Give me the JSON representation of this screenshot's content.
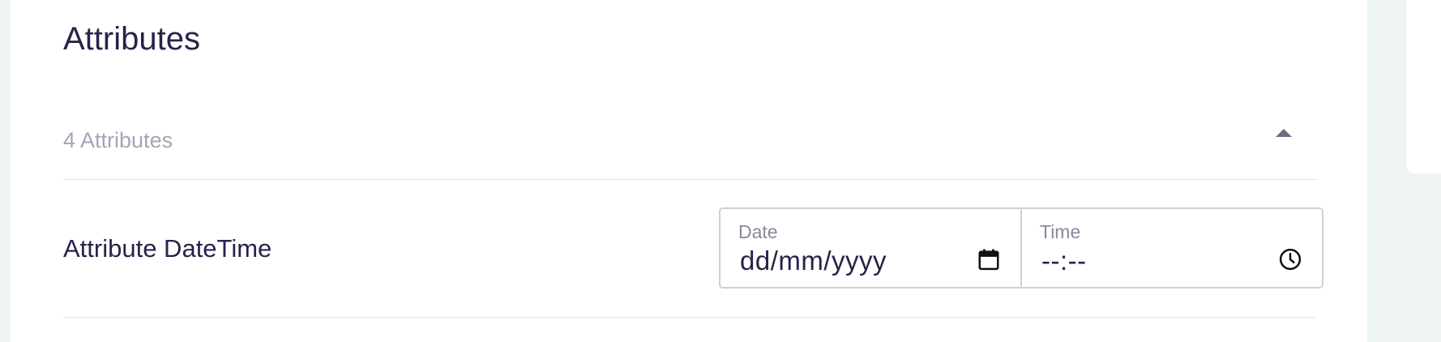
{
  "section": {
    "title": "Attributes"
  },
  "accordion": {
    "count_label": "4 Attributes",
    "expanded": true
  },
  "attributes": [
    {
      "label": "Attribute DateTime",
      "date": {
        "label": "Date",
        "placeholder": "dd/mm/yyyy",
        "icon": "calendar-icon"
      },
      "time": {
        "label": "Time",
        "placeholder": "--:--",
        "icon": "clock-icon"
      }
    }
  ],
  "colors": {
    "background": "#eff4f5",
    "card": "#ffffff",
    "text_primary": "#28234a",
    "text_muted": "#a6a5b5",
    "border": "#cfcfd6"
  }
}
